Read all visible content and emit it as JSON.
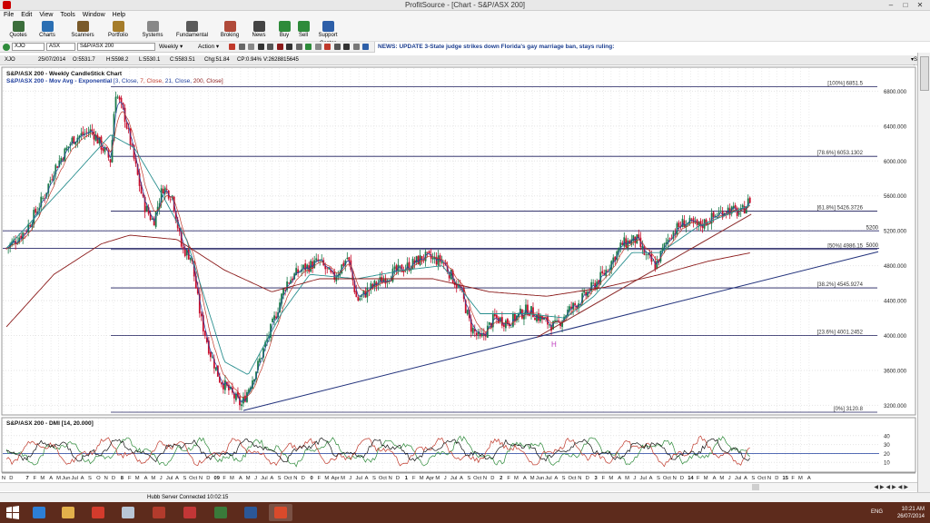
{
  "window": {
    "title": "ProfitSource - [Chart - S&P/ASX 200]"
  },
  "menu": [
    "File",
    "Edit",
    "View",
    "Tools",
    "Window",
    "Help"
  ],
  "toolbar": [
    {
      "label": "Quotes",
      "color": "#3b6e3b"
    },
    {
      "label": "Charts",
      "color": "#2b6fb3"
    },
    {
      "label": "Scanners",
      "color": "#7a5a2a"
    },
    {
      "label": "Portfolio",
      "color": "#a57c2a"
    },
    {
      "label": "Systems",
      "color": "#888888"
    },
    {
      "label": "Fundamental",
      "color": "#5a5a5a"
    },
    {
      "label": "Broking",
      "color": "#b04a3a"
    },
    {
      "label": "News",
      "color": "#444444"
    },
    {
      "label": "Buy",
      "color": "#2e8b3a"
    },
    {
      "label": "Sell",
      "color": "#2e8b3a"
    },
    {
      "label": "Support Center",
      "color": "#2d5fa8"
    }
  ],
  "symbol": {
    "code": "XJO",
    "exchange": "ASX",
    "name": "S&P/ASX 200",
    "period": "Weekly",
    "action": "Action"
  },
  "news": "NEWS: UPDATE 3-State judge strikes down Florida's gay marriage ban, stays ruling:",
  "quote": {
    "code": "XJO",
    "date": "25/07/2014",
    "open": "O:5531.7",
    "high": "H:5598.2",
    "low": "L:5530.1",
    "close": "C:5583.51",
    "change": "Chg:51.84",
    "change_pct": "CP:0.94%",
    "volume": "V:2628815645",
    "show_last": "Show Last"
  },
  "chart_data": {
    "type": "candlestick",
    "title": "S&P/ASX 200 - Weekly CandleStick Chart",
    "overlay_title": "S&P/ASX 200 - Mov Avg - Exponential",
    "overlay_params": [
      {
        "text": "[3, Close, ",
        "color": "#1f3f9e"
      },
      {
        "text": "7, Close, ",
        "color": "#c0392b"
      },
      {
        "text": "21, Close, ",
        "color": "#1f3f9e"
      },
      {
        "text": "200, Close]",
        "color": "#8b1a1a"
      }
    ],
    "ylim": [
      3100,
      6950
    ],
    "y_ticks": [
      3200,
      3600,
      4000,
      4400,
      4800,
      5200,
      5600,
      6000,
      6400,
      6800
    ],
    "fib_levels": [
      {
        "label": "[100%] 6851.5",
        "value": 6851.5
      },
      {
        "label": "[78.6%] 6053.1302",
        "value": 6053.1302
      },
      {
        "label": "[61.8%] 5426.3726",
        "value": 5426.3726
      },
      {
        "label": "[50%] 4986.15",
        "value": 4986.15
      },
      {
        "label": "[38.2%] 4545.9274",
        "value": 4545.9274
      },
      {
        "label": "[23.6%] 4001.2452",
        "value": 4001.2452
      },
      {
        "label": "[0%] 3120.8",
        "value": 3120.8
      }
    ],
    "extra_levels": [
      {
        "label": "5200",
        "value": 5200
      },
      {
        "label": "5000",
        "value": 5000
      }
    ],
    "anchors": [
      [
        2006.7,
        5000
      ],
      [
        2006.9,
        5200
      ],
      [
        2007.1,
        5600
      ],
      [
        2007.2,
        5900
      ],
      [
        2007.4,
        6250
      ],
      [
        2007.6,
        6350
      ],
      [
        2007.8,
        6000
      ],
      [
        2007.85,
        6800
      ],
      [
        2007.95,
        6500
      ],
      [
        2008.05,
        6000
      ],
      [
        2008.15,
        5500
      ],
      [
        2008.25,
        5300
      ],
      [
        2008.35,
        5700
      ],
      [
        2008.45,
        5600
      ],
      [
        2008.55,
        5000
      ],
      [
        2008.65,
        4900
      ],
      [
        2008.75,
        4200
      ],
      [
        2008.85,
        3800
      ],
      [
        2008.95,
        3500
      ],
      [
        2009.1,
        3300
      ],
      [
        2009.18,
        3200
      ],
      [
        2009.35,
        3650
      ],
      [
        2009.5,
        4100
      ],
      [
        2009.65,
        4600
      ],
      [
        2009.8,
        4750
      ],
      [
        2010.0,
        4850
      ],
      [
        2010.15,
        4650
      ],
      [
        2010.3,
        4900
      ],
      [
        2010.4,
        4400
      ],
      [
        2010.55,
        4550
      ],
      [
        2010.75,
        4700
      ],
      [
        2010.95,
        4800
      ],
      [
        2011.1,
        4900
      ],
      [
        2011.3,
        4850
      ],
      [
        2011.5,
        4500
      ],
      [
        2011.6,
        4100
      ],
      [
        2011.7,
        3950
      ],
      [
        2011.85,
        4200
      ],
      [
        2012.0,
        4150
      ],
      [
        2012.2,
        4300
      ],
      [
        2012.4,
        4150
      ],
      [
        2012.5,
        4100
      ],
      [
        2012.6,
        4250
      ],
      [
        2012.8,
        4450
      ],
      [
        2013.0,
        4700
      ],
      [
        2013.2,
        5050
      ],
      [
        2013.35,
        5100
      ],
      [
        2013.45,
        4900
      ],
      [
        2013.55,
        4800
      ],
      [
        2013.7,
        5150
      ],
      [
        2013.85,
        5300
      ],
      [
        2014.0,
        5250
      ],
      [
        2014.15,
        5350
      ],
      [
        2014.3,
        5450
      ],
      [
        2014.45,
        5400
      ],
      [
        2014.56,
        5583.51
      ]
    ],
    "ema21_anchors": [
      [
        2006.7,
        5000
      ],
      [
        2007.3,
        5700
      ],
      [
        2007.8,
        6300
      ],
      [
        2008.05,
        6150
      ],
      [
        2008.35,
        5600
      ],
      [
        2008.6,
        5100
      ],
      [
        2008.8,
        4400
      ],
      [
        2009.0,
        3700
      ],
      [
        2009.25,
        3550
      ],
      [
        2009.6,
        4250
      ],
      [
        2009.9,
        4700
      ],
      [
        2010.4,
        4650
      ],
      [
        2010.9,
        4750
      ],
      [
        2011.3,
        4800
      ],
      [
        2011.7,
        4250
      ],
      [
        2012.2,
        4250
      ],
      [
        2012.6,
        4200
      ],
      [
        2012.9,
        4450
      ],
      [
        2013.3,
        4950
      ],
      [
        2013.6,
        4950
      ],
      [
        2014.0,
        5250
      ],
      [
        2014.56,
        5500
      ]
    ],
    "ema200_anchors": [
      [
        2006.7,
        4100
      ],
      [
        2007.2,
        4700
      ],
      [
        2007.7,
        5050
      ],
      [
        2008.0,
        5150
      ],
      [
        2008.5,
        5100
      ],
      [
        2009.0,
        4750
      ],
      [
        2009.5,
        4500
      ],
      [
        2010.0,
        4650
      ],
      [
        2010.6,
        4650
      ],
      [
        2011.2,
        4650
      ],
      [
        2011.8,
        4500
      ],
      [
        2012.4,
        4450
      ],
      [
        2013.0,
        4550
      ],
      [
        2013.6,
        4700
      ],
      [
        2014.1,
        4850
      ],
      [
        2014.56,
        4950
      ]
    ],
    "trendlines": [
      {
        "from": [
          2009.2,
          3140
        ],
        "to": [
          2015.9,
          4960
        ],
        "color": "#1f2f7a"
      },
      {
        "from": [
          2012.3,
          3980
        ],
        "to": [
          2014.56,
          5390
        ],
        "color": "#8b2a2a"
      }
    ],
    "x_range": [
      2006.67,
      2015.9
    ],
    "x_ticks": [
      [
        "N",
        2006.67
      ],
      [
        "D",
        2006.75
      ],
      [
        "7",
        2006.92
      ],
      [
        "F",
        2007.0
      ],
      [
        "M",
        2007.08
      ],
      [
        "A",
        2007.17
      ],
      [
        "M",
        2007.25
      ],
      [
        "Jun",
        2007.33
      ],
      [
        "Jul",
        2007.42
      ],
      [
        "A",
        2007.5
      ],
      [
        "S",
        2007.58
      ],
      [
        "O",
        2007.67
      ],
      [
        "N",
        2007.75
      ],
      [
        "D",
        2007.83
      ],
      [
        "8",
        2007.92
      ],
      [
        "F",
        2008.0
      ],
      [
        "M",
        2008.08
      ],
      [
        "A",
        2008.17
      ],
      [
        "M",
        2008.25
      ],
      [
        "J",
        2008.33
      ],
      [
        "Jul",
        2008.42
      ],
      [
        "A",
        2008.5
      ],
      [
        "S",
        2008.58
      ],
      [
        "Oct",
        2008.67
      ],
      [
        "N",
        2008.75
      ],
      [
        "D",
        2008.83
      ],
      [
        "09",
        2008.92
      ],
      [
        "F",
        2009.0
      ],
      [
        "M",
        2009.08
      ],
      [
        "A",
        2009.17
      ],
      [
        "M",
        2009.25
      ],
      [
        "J",
        2009.33
      ],
      [
        "Jul",
        2009.42
      ],
      [
        "A",
        2009.5
      ],
      [
        "S",
        2009.58
      ],
      [
        "Oct",
        2009.67
      ],
      [
        "N",
        2009.75
      ],
      [
        "D",
        2009.83
      ],
      [
        "0",
        2009.92
      ],
      [
        "F",
        2010.0
      ],
      [
        "M",
        2010.08
      ],
      [
        "Apr",
        2010.17
      ],
      [
        "M",
        2010.25
      ],
      [
        "J",
        2010.33
      ],
      [
        "Jul",
        2010.42
      ],
      [
        "A",
        2010.5
      ],
      [
        "S",
        2010.58
      ],
      [
        "Oct",
        2010.67
      ],
      [
        "N",
        2010.75
      ],
      [
        "D",
        2010.83
      ],
      [
        "1",
        2010.92
      ],
      [
        "F",
        2011.0
      ],
      [
        "M",
        2011.08
      ],
      [
        "Apr",
        2011.17
      ],
      [
        "M",
        2011.25
      ],
      [
        "J",
        2011.33
      ],
      [
        "Jul",
        2011.42
      ],
      [
        "A",
        2011.5
      ],
      [
        "S",
        2011.58
      ],
      [
        "Oct",
        2011.67
      ],
      [
        "N",
        2011.75
      ],
      [
        "D",
        2011.83
      ],
      [
        "2",
        2011.92
      ],
      [
        "F",
        2012.0
      ],
      [
        "M",
        2012.08
      ],
      [
        "A",
        2012.17
      ],
      [
        "M",
        2012.25
      ],
      [
        "Jun",
        2012.33
      ],
      [
        "Jul",
        2012.42
      ],
      [
        "A",
        2012.5
      ],
      [
        "S",
        2012.58
      ],
      [
        "Oct",
        2012.67
      ],
      [
        "N",
        2012.75
      ],
      [
        "D",
        2012.83
      ],
      [
        "3",
        2012.92
      ],
      [
        "F",
        2013.0
      ],
      [
        "M",
        2013.08
      ],
      [
        "A",
        2013.17
      ],
      [
        "M",
        2013.25
      ],
      [
        "J",
        2013.33
      ],
      [
        "Jul",
        2013.42
      ],
      [
        "A",
        2013.5
      ],
      [
        "S",
        2013.58
      ],
      [
        "Oct",
        2013.67
      ],
      [
        "N",
        2013.75
      ],
      [
        "D",
        2013.83
      ],
      [
        "14",
        2013.92
      ],
      [
        "F",
        2014.0
      ],
      [
        "M",
        2014.08
      ],
      [
        "A",
        2014.17
      ],
      [
        "M",
        2014.25
      ],
      [
        "J",
        2014.33
      ],
      [
        "Jul",
        2014.42
      ],
      [
        "A",
        2014.5
      ],
      [
        "S",
        2014.58
      ],
      [
        "Oct",
        2014.67
      ],
      [
        "N",
        2014.75
      ],
      [
        "D",
        2014.83
      ],
      [
        "15",
        2014.92
      ],
      [
        "F",
        2015.0
      ],
      [
        "M",
        2015.08
      ],
      [
        "A",
        2015.17
      ]
    ],
    "dmi": {
      "title": "S&P/ASX 200 - DMI [14, 20.000]",
      "ylim": [
        0,
        50
      ],
      "y_ticks": [
        10,
        20,
        30,
        40
      ],
      "ref_level": 20,
      "colors": {
        "plus_di": "#2e8b3a",
        "minus_di": "#c0392b",
        "adx": "#111111",
        "ref": "#1f3f9e"
      }
    },
    "annotation": "H",
    "colors": {
      "up": "#1a7a4a",
      "down": "#c8102e",
      "ema3": "#1f3f9e",
      "ema7": "#c0392b",
      "ema21": "#2a8f8f",
      "ema200": "#8b1a1a",
      "fib": "#1a1a5a"
    }
  },
  "status": {
    "text": "Hubb Server Connected 10:02:15"
  },
  "taskbar": {
    "apps": [
      {
        "name": "internet-explorer",
        "color": "#2d7fd6"
      },
      {
        "name": "file-explorer",
        "color": "#e3b04b"
      },
      {
        "name": "chrome",
        "color": "#d33b2c"
      },
      {
        "name": "notepad",
        "color": "#b9c6d6"
      },
      {
        "name": "pdf-reader",
        "color": "#b23b2c"
      },
      {
        "name": "photo-app",
        "color": "#c23636"
      },
      {
        "name": "chart-app",
        "color": "#3a7a3a"
      },
      {
        "name": "word",
        "color": "#2b5797"
      },
      {
        "name": "profitsource",
        "color": "#d94a2b"
      }
    ],
    "lang": "ENG",
    "time": "10:21 AM",
    "date": "26/07/2014"
  }
}
